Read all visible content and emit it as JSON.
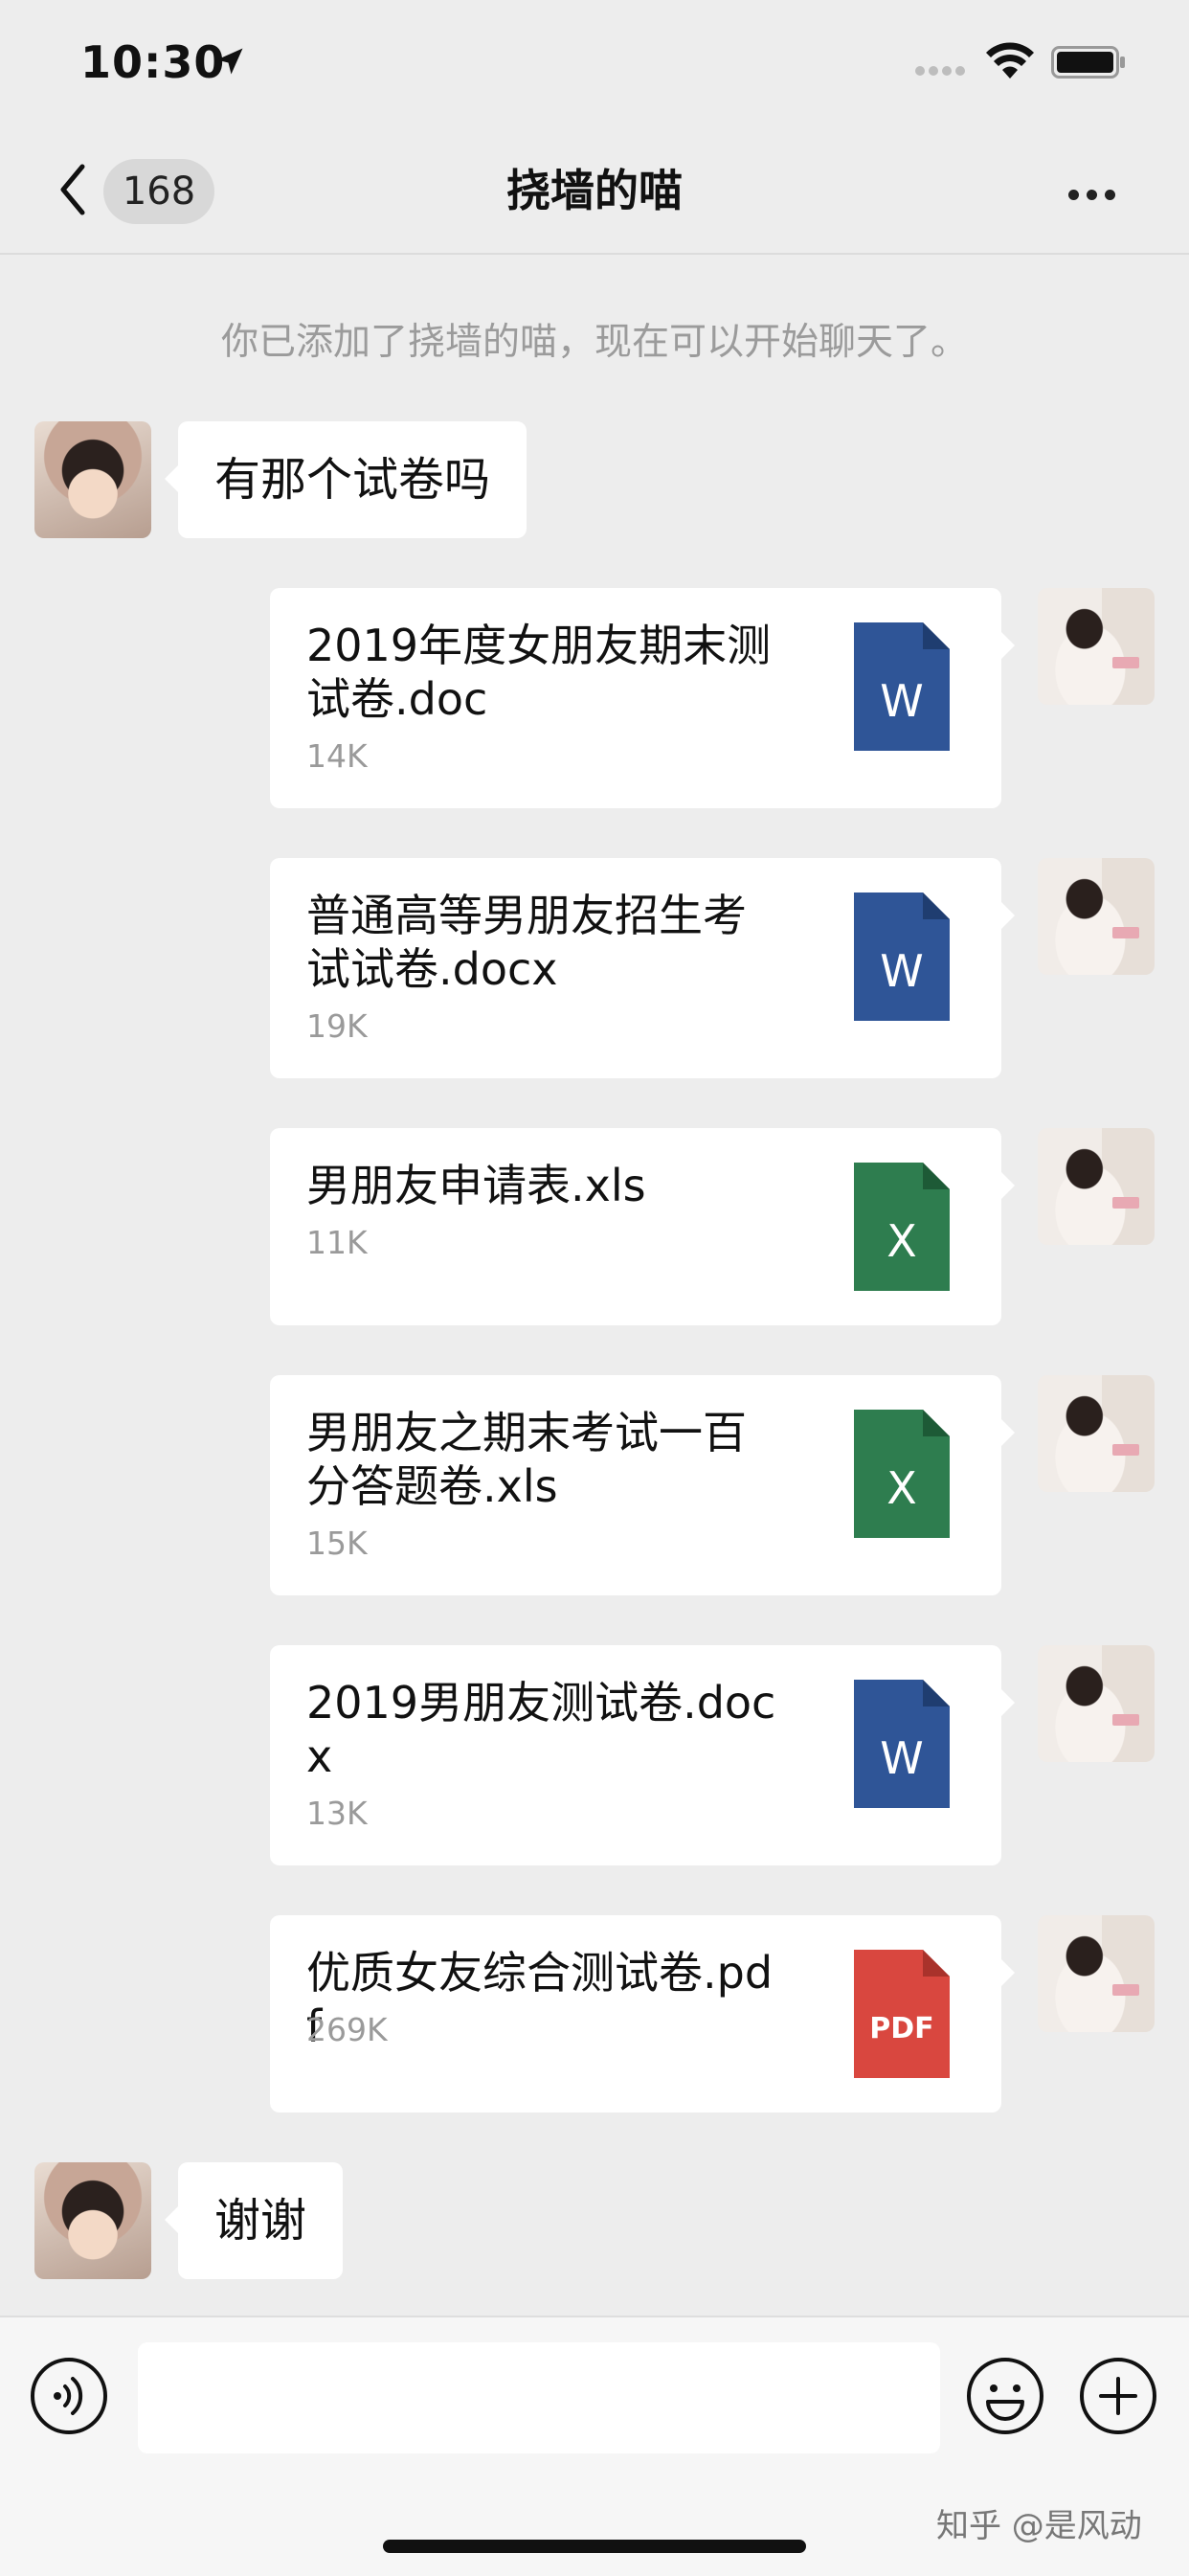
{
  "status_bar": {
    "time": "10:30"
  },
  "nav": {
    "back_count": "168",
    "title": "挠墙的喵"
  },
  "system_message": "你已添加了挠墙的喵，现在可以开始聊天了。",
  "messages": {
    "m1": "有那个试卷吗",
    "m2": "谢谢"
  },
  "files": [
    {
      "name": "2019年度女朋友期末测试卷.doc",
      "size": "14K",
      "type": "W"
    },
    {
      "name": "普通高等男朋友招生考试试卷.docx",
      "size": "19K",
      "type": "W"
    },
    {
      "name": "男朋友申请表.xls",
      "size": "11K",
      "type": "X"
    },
    {
      "name": "男朋友之期末考试一百分答题卷.xls",
      "size": "15K",
      "type": "X"
    },
    {
      "name": "2019男朋友测试卷.docx",
      "size": "13K",
      "type": "W"
    },
    {
      "name": "优质女友综合测试卷.pdf",
      "size": "269K",
      "type": "PDF"
    }
  ],
  "icons": {
    "word": "word-file-icon",
    "excel": "excel-file-icon",
    "pdf": "pdf-file-icon",
    "word_color": "#2f5597",
    "excel_color": "#2e7d4f",
    "pdf_color": "#d9473f"
  },
  "watermark": "知乎 @是风动"
}
